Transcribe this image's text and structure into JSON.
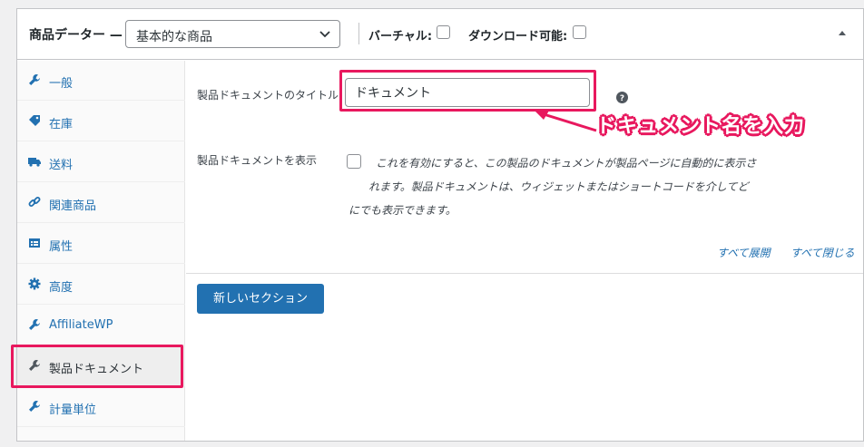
{
  "header": {
    "title": "商品データー —",
    "product_type": "基本的な商品",
    "virtual_label": "バーチャル:",
    "downloadable_label": "ダウンロード可能:"
  },
  "sidebar": {
    "items": [
      {
        "label": "一般",
        "icon": "wrench-icon"
      },
      {
        "label": "在庫",
        "icon": "tag-icon"
      },
      {
        "label": "送料",
        "icon": "truck-icon"
      },
      {
        "label": "関連商品",
        "icon": "link-icon"
      },
      {
        "label": "属性",
        "icon": "table-icon"
      },
      {
        "label": "高度",
        "icon": "gear-icon"
      },
      {
        "label": "AffiliateWP",
        "icon": "wrench-icon"
      },
      {
        "label": "製品ドキュメント",
        "icon": "wrench-icon",
        "active": true
      },
      {
        "label": "計量単位",
        "icon": "wrench-icon"
      }
    ]
  },
  "main": {
    "doc_title_label": "製品ドキュメントのタイトル",
    "doc_title_value": "ドキュメント",
    "show_label": "製品ドキュメントを表示",
    "show_desc_1": "これを有効にすると、この製品のドキュメントが製品ページに自動的に表示さ",
    "show_desc_2": "れます。製品ドキュメントは、ウィジェットまたはショートコードを介してど",
    "show_desc_3": "にでも表示できます。",
    "expand_all": "すべて展開",
    "collapse_all": "すべて閉じる",
    "new_section_button": "新しいセクション"
  },
  "annotation": {
    "text": "ドキュメント名を入力",
    "color": "#e8185e"
  },
  "colors": {
    "link": "#2271b1",
    "button": "#2271b1",
    "highlight": "#e8185e"
  }
}
